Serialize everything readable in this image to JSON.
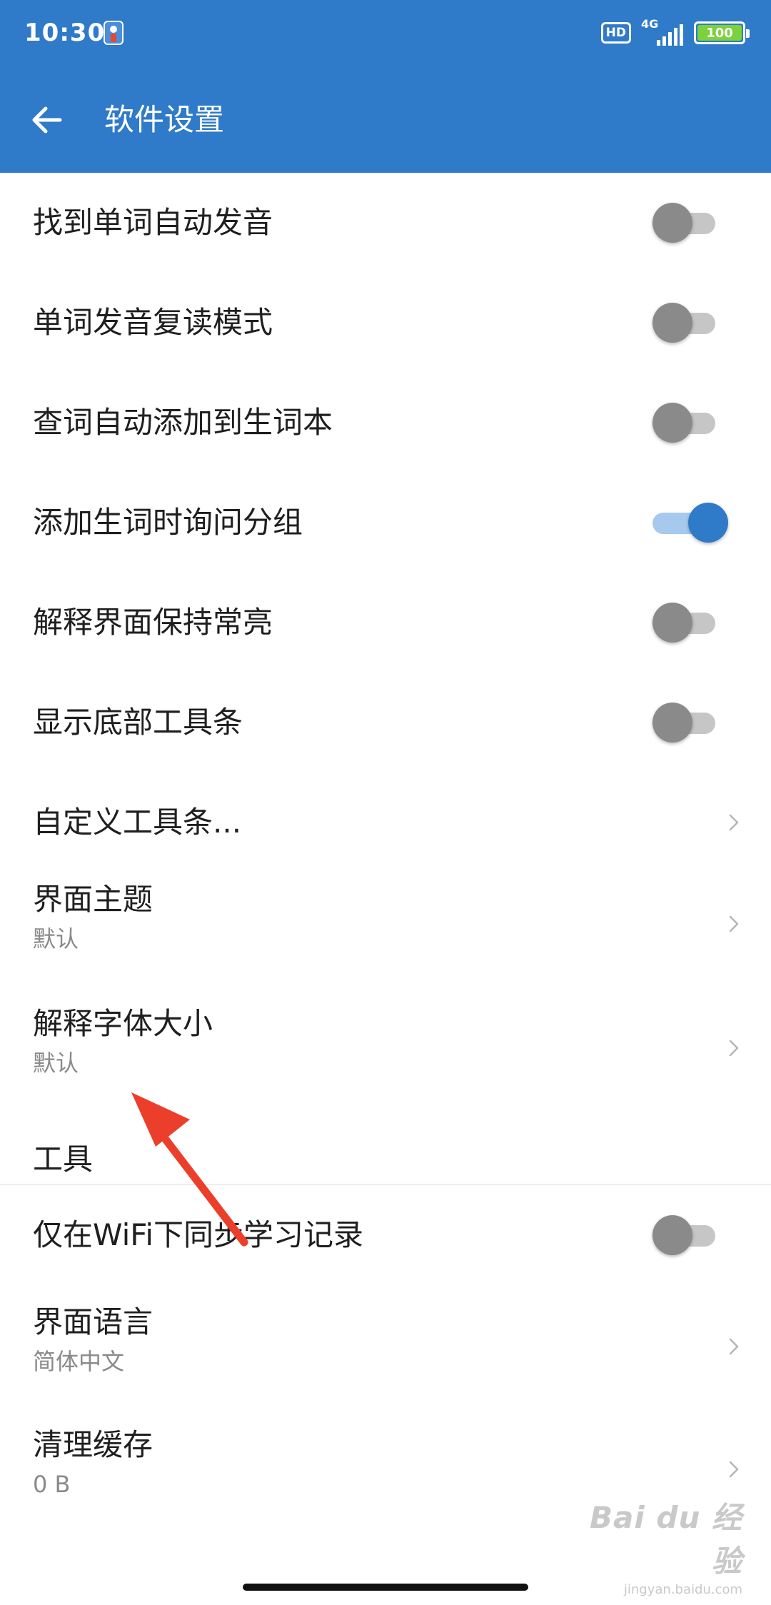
{
  "status_bar": {
    "time": "10:30",
    "hd_label": "HD",
    "network_label": "4G",
    "battery": "100"
  },
  "app_bar": {
    "title": "软件设置"
  },
  "settings": {
    "items": [
      {
        "label": "找到单词自动发音",
        "toggle": false
      },
      {
        "label": "单词发音复读模式",
        "toggle": false
      },
      {
        "label": "查词自动添加到生词本",
        "toggle": false
      },
      {
        "label": "添加生词时询问分组",
        "toggle": true
      },
      {
        "label": "解释界面保持常亮",
        "toggle": false
      },
      {
        "label": "显示底部工具条",
        "toggle": false
      },
      {
        "label": "自定义工具条..."
      },
      {
        "label": "界面主题",
        "value": "默认"
      },
      {
        "label": "解释字体大小",
        "value": "默认"
      }
    ],
    "section_tools": "工具",
    "tools_items": [
      {
        "label": "仅在WiFi下同步学习记录",
        "toggle": false
      },
      {
        "label": "界面语言",
        "value": "简体中文"
      },
      {
        "label": "清理缓存",
        "value": "0 B"
      }
    ]
  },
  "watermark": {
    "logo": "Bai du 经验",
    "url": "jingyan.baidu.com"
  },
  "colors": {
    "primary": "#2f7ac9",
    "toggle_off_thumb": "#8a8a8a",
    "annotation": "#ec3f2b"
  }
}
